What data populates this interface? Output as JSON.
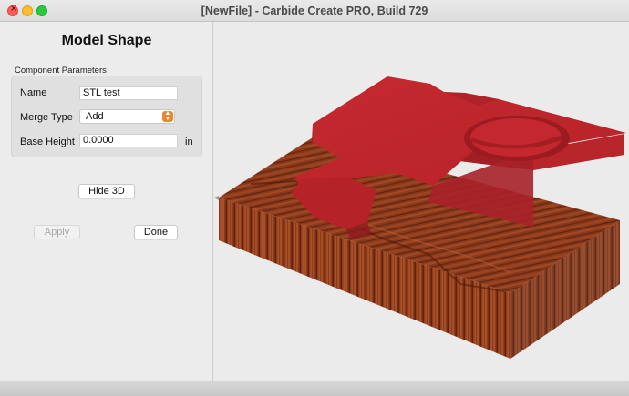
{
  "window": {
    "title": "[NewFile] - Carbide Create PRO, Build 729"
  },
  "panel": {
    "title": "Model Shape",
    "group_label": "Component Parameters",
    "name_label": "Name",
    "name_value": "STL test",
    "merge_label": "Merge Type",
    "merge_value": "Add",
    "base_label": "Base Height",
    "base_value": "0.0000",
    "unit": "in",
    "hide3d": "Hide 3D",
    "apply": "Apply",
    "done": "Done"
  },
  "colors": {
    "model_red": "#c0272d",
    "wood": "#8b3a1e",
    "accent_orange": "#e8892f"
  }
}
